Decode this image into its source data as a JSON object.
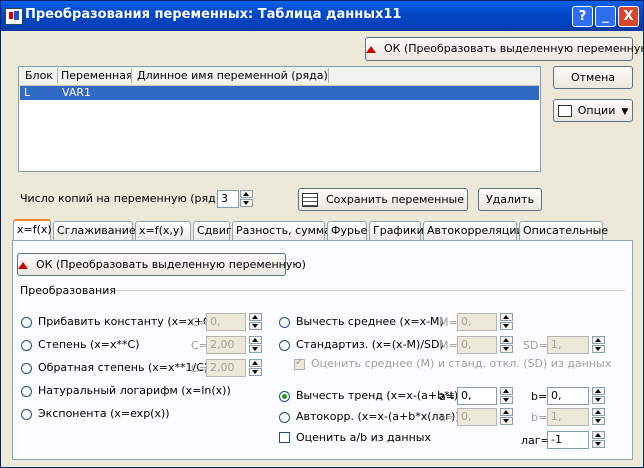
{
  "window": {
    "title": "Преобразования переменных: Таблица данных11",
    "help_label": "?",
    "min_label": "_",
    "close_label": "X"
  },
  "top": {
    "ok_label": "ОК (Преобразовать выделенную переменную)",
    "cancel_label": "Отмена",
    "options_label": "Опции"
  },
  "list": {
    "columns": [
      "Блок",
      "Переменная",
      "Длинное имя переменной (ряда)"
    ],
    "rows": [
      {
        "block": "L",
        "variable": "VAR1",
        "long_name": ""
      }
    ]
  },
  "copies": {
    "label": "Число копий на переменную (ряд):",
    "value": "3",
    "save_label": "Сохранить переменные",
    "delete_label": "Удалить"
  },
  "tabs": [
    "x=f(x)",
    "Сглаживание",
    "x=f(x,y)",
    "Сдвиг",
    "Разность, сумма",
    "Фурье",
    "Графики",
    "Автокорреляции",
    "Описательные"
  ],
  "panel": {
    "ok_label": "ОК (Преобразовать выделенную переменную)",
    "group_label": "Преобразования",
    "left": [
      {
        "label": "Прибавить константу (x=x+C)",
        "param": "C=",
        "value": "0,"
      },
      {
        "label": "Степень (x=x**C)",
        "param": "C=",
        "value": "2,00"
      },
      {
        "label": "Обратная степень (x=x**1/C)",
        "param": "C=",
        "value": "2,00"
      },
      {
        "label": "Натуральный логарифм (x=ln(x))"
      },
      {
        "label": "Экспонента (x=exp(x))"
      }
    ],
    "subtract_mean": {
      "label": "Вычесть среднее (x=x-M)",
      "param": "M=",
      "value": "0,"
    },
    "standardize": {
      "label": "Стандартиз. (x=(x-M)/SD)",
      "m_param": "M=",
      "m_value": "0,",
      "sd_param": "SD=",
      "sd_value": "1,"
    },
    "estimate_mean_sd": "Оценить среднее (M) и станд. откл. (SD) из данных",
    "detrend": {
      "label": "Вычесть тренд (x=x-(a+b*t))",
      "a_param": "a=",
      "a_value": "0,",
      "b_param": "b=",
      "b_value": "0,"
    },
    "autocorr": {
      "label": "Автокорр. (x=x-(a+b*x(лаг)))",
      "a_param": "a=",
      "a_value": "0,",
      "b_param": "b=",
      "b_value": "1,"
    },
    "estimate_ab": "Оценить a/b из данных",
    "lag_label": "лаг=",
    "lag_value": "-1"
  },
  "colors": {
    "titlebar": "#0348c8",
    "selection": "#3169c6",
    "tab_accent": "#e68b2c",
    "dialog_bg": "#ece9d8"
  },
  "icons": {
    "ok_icon": "house-arrow-icon",
    "options_icon": "options-icon",
    "save_icon": "spreadsheet-icon"
  }
}
